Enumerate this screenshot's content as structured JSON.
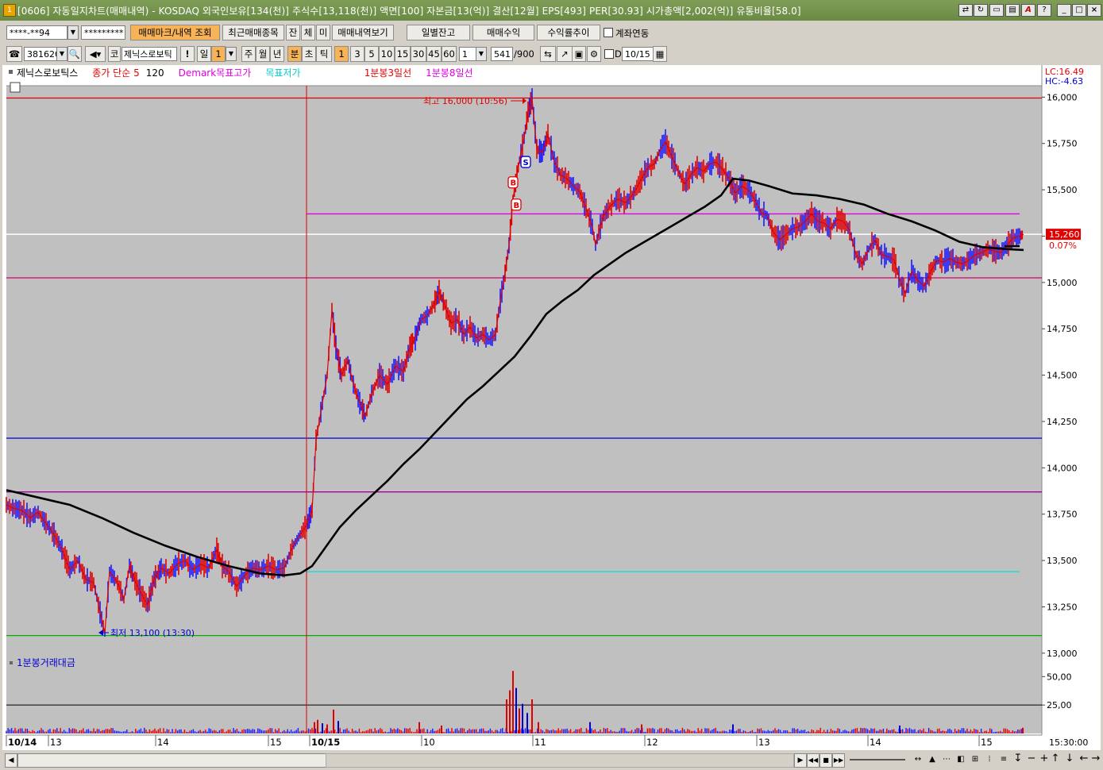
{
  "window": {
    "title": "[0606] 자동일지차트(매매내역) - KOSDAQ 외국인보유[134(천)] 주식수[13,118(천)] 액면[100] 자본금[13(억)] 결산[12월] EPS[493] PER[30.93] 시가총액[2,002(억)] 유통비율[58.0]",
    "icon": "app-icon"
  },
  "toolbar1": {
    "account": "****-**94",
    "password": "*********",
    "btn_trade_mark": "매매마크/내역 조회",
    "btn_recent_trades": "최근매매종목",
    "btn_jan": "잔",
    "btn_che": "체",
    "btn_mi": "미",
    "btn_trade_history": "매매내역보기",
    "btn_daily_balance": "일별잔고",
    "btn_profit": "매매수익",
    "btn_return_trend": "수익률추이",
    "link_account_label": "계좌연동"
  },
  "toolbar2": {
    "code": "381620",
    "name": "제닉스로보틱",
    "market_tag": "코",
    "bang": "!",
    "periods": [
      "일",
      "1",
      "주",
      "월",
      "년",
      "분",
      "초",
      "틱"
    ],
    "minute_values": [
      "1",
      "3",
      "5",
      "10",
      "15",
      "30",
      "45",
      "60"
    ],
    "interval": "1",
    "count": "541",
    "count_max": "/900",
    "date_check_label": "D",
    "date": "10/15"
  },
  "chart_data": {
    "type": "line",
    "legend": [
      {
        "name": "제닉스로보틱스",
        "color": "#000000"
      },
      {
        "name": "종가 단순 5",
        "color": "#e60000"
      },
      {
        "name": "120",
        "color": "#000000"
      },
      {
        "name": "Demark목표고가",
        "color": "#e000e0"
      },
      {
        "name": "목표저가",
        "color": "#00cccc"
      },
      {
        "name": "단기과열",
        "color": "#ffffff"
      },
      {
        "name": "1분봉3일선",
        "color": "#e60000"
      },
      {
        "name": "1분봉8일선",
        "color": "#e000e0"
      }
    ],
    "corner_lc": "LC:16.49",
    "corner_hc": "HC:-4.63",
    "y_ticks": [
      "16,000",
      "15,750",
      "15,500",
      "15,250",
      "15,000",
      "14,750",
      "14,500",
      "14,250",
      "14,000",
      "13,750",
      "13,500",
      "13,250",
      "13,000"
    ],
    "y_tick_values": [
      16000,
      15750,
      15500,
      15250,
      15000,
      14750,
      14500,
      14250,
      14000,
      13750,
      13500,
      13250,
      13000
    ],
    "ylim": [
      12995,
      16010
    ],
    "x_labels": [
      "10/14",
      "13",
      "14",
      "15",
      "10/15",
      "10",
      "11",
      "12",
      "13",
      "14",
      "15"
    ],
    "x_time_label": "15:30:00",
    "current_price": "15,260",
    "current_price_value": 15260,
    "current_change": "0.07%",
    "high_annotation": "최고 16,000 (10:56)",
    "low_annotation": "최저 13,100 (13:30)",
    "h_lines": [
      {
        "name": "red-top",
        "value": 15995,
        "color": "#e00000",
        "from": "10/14"
      },
      {
        "name": "magenta-demark-high",
        "value": 15370,
        "color": "#e000e0",
        "from": "10/15"
      },
      {
        "name": "current-price",
        "value": 15260,
        "color": "#ffffff",
        "from": "10/14"
      },
      {
        "name": "deep-pink",
        "value": 15025,
        "color": "#d6006b",
        "from": "10/14"
      },
      {
        "name": "blue",
        "value": 14160,
        "color": "#0000d0",
        "from": "10/14"
      },
      {
        "name": "purple",
        "value": 13870,
        "color": "#a000a0",
        "from": "10/14"
      },
      {
        "name": "cyan-target-low",
        "value": 13440,
        "color": "#00e0e0",
        "from": "10/15"
      },
      {
        "name": "green",
        "value": 13095,
        "color": "#00b000",
        "from": "10/14"
      }
    ],
    "price_path": [
      [
        0,
        13800
      ],
      [
        10,
        13780
      ],
      [
        20,
        13770
      ],
      [
        30,
        13730
      ],
      [
        40,
        13760
      ],
      [
        50,
        13700
      ],
      [
        60,
        13640
      ],
      [
        70,
        13560
      ],
      [
        80,
        13450
      ],
      [
        90,
        13500
      ],
      [
        100,
        13400
      ],
      [
        110,
        13380
      ],
      [
        118,
        13220
      ],
      [
        124,
        13110
      ],
      [
        130,
        13440
      ],
      [
        140,
        13380
      ],
      [
        148,
        13290
      ],
      [
        155,
        13470
      ],
      [
        162,
        13390
      ],
      [
        170,
        13320
      ],
      [
        178,
        13260
      ],
      [
        186,
        13400
      ],
      [
        195,
        13460
      ],
      [
        205,
        13430
      ],
      [
        215,
        13480
      ],
      [
        225,
        13500
      ],
      [
        235,
        13450
      ],
      [
        245,
        13480
      ],
      [
        255,
        13460
      ],
      [
        265,
        13560
      ],
      [
        272,
        13470
      ],
      [
        280,
        13440
      ],
      [
        290,
        13360
      ],
      [
        300,
        13420
      ],
      [
        310,
        13460
      ],
      [
        320,
        13450
      ],
      [
        330,
        13470
      ],
      [
        340,
        13450
      ],
      [
        350,
        13460
      ],
      [
        360,
        13570
      ],
      [
        370,
        13640
      ],
      [
        378,
        13690
      ],
      [
        385,
        13770
      ],
      [
        390,
        14150
      ],
      [
        396,
        14300
      ],
      [
        404,
        14500
      ],
      [
        410,
        14850
      ],
      [
        415,
        14650
      ],
      [
        422,
        14500
      ],
      [
        430,
        14580
      ],
      [
        437,
        14450
      ],
      [
        445,
        14350
      ],
      [
        452,
        14280
      ],
      [
        460,
        14400
      ],
      [
        470,
        14500
      ],
      [
        480,
        14450
      ],
      [
        490,
        14550
      ],
      [
        500,
        14520
      ],
      [
        508,
        14650
      ],
      [
        515,
        14700
      ],
      [
        522,
        14800
      ],
      [
        530,
        14820
      ],
      [
        538,
        14880
      ],
      [
        545,
        14950
      ],
      [
        552,
        14880
      ],
      [
        560,
        14780
      ],
      [
        568,
        14800
      ],
      [
        576,
        14720
      ],
      [
        584,
        14760
      ],
      [
        592,
        14700
      ],
      [
        600,
        14720
      ],
      [
        608,
        14690
      ],
      [
        616,
        14720
      ],
      [
        622,
        14900
      ],
      [
        628,
        15050
      ],
      [
        633,
        15200
      ],
      [
        638,
        15450
      ],
      [
        643,
        15580
      ],
      [
        648,
        15700
      ],
      [
        652,
        15780
      ],
      [
        657,
        15920
      ],
      [
        662,
        15990
      ],
      [
        668,
        15720
      ],
      [
        675,
        15700
      ],
      [
        682,
        15800
      ],
      [
        690,
        15650
      ],
      [
        698,
        15580
      ],
      [
        706,
        15560
      ],
      [
        714,
        15520
      ],
      [
        722,
        15490
      ],
      [
        730,
        15400
      ],
      [
        738,
        15300
      ],
      [
        742,
        15200
      ],
      [
        746,
        15270
      ],
      [
        752,
        15360
      ],
      [
        760,
        15410
      ],
      [
        770,
        15450
      ],
      [
        780,
        15430
      ],
      [
        790,
        15480
      ],
      [
        800,
        15560
      ],
      [
        808,
        15620
      ],
      [
        816,
        15640
      ],
      [
        824,
        15720
      ],
      [
        830,
        15760
      ],
      [
        838,
        15680
      ],
      [
        846,
        15600
      ],
      [
        854,
        15530
      ],
      [
        862,
        15580
      ],
      [
        870,
        15620
      ],
      [
        878,
        15600
      ],
      [
        886,
        15640
      ],
      [
        894,
        15650
      ],
      [
        902,
        15610
      ],
      [
        910,
        15560
      ],
      [
        918,
        15480
      ],
      [
        926,
        15520
      ],
      [
        934,
        15500
      ],
      [
        942,
        15450
      ],
      [
        950,
        15380
      ],
      [
        958,
        15360
      ],
      [
        966,
        15270
      ],
      [
        974,
        15230
      ],
      [
        982,
        15260
      ],
      [
        990,
        15290
      ],
      [
        998,
        15300
      ],
      [
        1006,
        15330
      ],
      [
        1014,
        15370
      ],
      [
        1022,
        15330
      ],
      [
        1030,
        15320
      ],
      [
        1038,
        15290
      ],
      [
        1046,
        15340
      ],
      [
        1054,
        15330
      ],
      [
        1062,
        15280
      ],
      [
        1070,
        15150
      ],
      [
        1078,
        15100
      ],
      [
        1086,
        15180
      ],
      [
        1094,
        15230
      ],
      [
        1102,
        15150
      ],
      [
        1110,
        15140
      ],
      [
        1118,
        15120
      ],
      [
        1126,
        15000
      ],
      [
        1132,
        14940
      ],
      [
        1140,
        15060
      ],
      [
        1148,
        15010
      ],
      [
        1156,
        14980
      ],
      [
        1164,
        15060
      ],
      [
        1172,
        15120
      ],
      [
        1180,
        15110
      ],
      [
        1188,
        15130
      ],
      [
        1196,
        15110
      ],
      [
        1204,
        15100
      ],
      [
        1212,
        15120
      ],
      [
        1220,
        15150
      ],
      [
        1228,
        15160
      ],
      [
        1236,
        15180
      ],
      [
        1244,
        15170
      ],
      [
        1252,
        15160
      ],
      [
        1260,
        15200
      ],
      [
        1268,
        15240
      ],
      [
        1276,
        15250
      ],
      [
        1281,
        15260
      ]
    ],
    "ma120_path": [
      [
        0,
        13880
      ],
      [
        40,
        13840
      ],
      [
        80,
        13800
      ],
      [
        120,
        13730
      ],
      [
        160,
        13650
      ],
      [
        200,
        13580
      ],
      [
        240,
        13520
      ],
      [
        280,
        13470
      ],
      [
        320,
        13430
      ],
      [
        350,
        13420
      ],
      [
        370,
        13430
      ],
      [
        385,
        13470
      ],
      [
        400,
        13560
      ],
      [
        420,
        13680
      ],
      [
        440,
        13770
      ],
      [
        460,
        13850
      ],
      [
        480,
        13930
      ],
      [
        500,
        14020
      ],
      [
        520,
        14100
      ],
      [
        540,
        14190
      ],
      [
        560,
        14280
      ],
      [
        580,
        14370
      ],
      [
        600,
        14440
      ],
      [
        620,
        14520
      ],
      [
        640,
        14600
      ],
      [
        660,
        14710
      ],
      [
        680,
        14830
      ],
      [
        700,
        14900
      ],
      [
        720,
        14960
      ],
      [
        740,
        15040
      ],
      [
        760,
        15100
      ],
      [
        780,
        15160
      ],
      [
        800,
        15210
      ],
      [
        820,
        15260
      ],
      [
        840,
        15310
      ],
      [
        860,
        15360
      ],
      [
        880,
        15410
      ],
      [
        900,
        15470
      ],
      [
        915,
        15560
      ],
      [
        935,
        15550
      ],
      [
        960,
        15520
      ],
      [
        990,
        15480
      ],
      [
        1020,
        15470
      ],
      [
        1050,
        15450
      ],
      [
        1080,
        15420
      ],
      [
        1110,
        15370
      ],
      [
        1140,
        15330
      ],
      [
        1170,
        15280
      ],
      [
        1200,
        15220
      ],
      [
        1230,
        15190
      ],
      [
        1260,
        15180
      ],
      [
        1281,
        15175
      ]
    ],
    "signals": [
      {
        "label": "S",
        "x": 654,
        "value": 15650
      },
      {
        "label": "B",
        "x": 638,
        "value": 15540
      },
      {
        "label": "B",
        "x": 642,
        "value": 15420
      }
    ],
    "volume_panel": {
      "label": "1분봉거래대금",
      "y_ticks": [
        "50,00",
        "25,00"
      ],
      "y_tick_values": [
        50,
        25
      ],
      "ymax": 60,
      "ref_line_value": 25,
      "spikes": [
        {
          "x": 388,
          "value": 10,
          "color": "#e00000"
        },
        {
          "x": 392,
          "value": 12,
          "color": "#e00000"
        },
        {
          "x": 398,
          "value": 9,
          "color": "#0000d0"
        },
        {
          "x": 404,
          "value": 8,
          "color": "#e00000"
        },
        {
          "x": 412,
          "value": 21,
          "color": "#e00000"
        },
        {
          "x": 418,
          "value": 11,
          "color": "#0000d0"
        },
        {
          "x": 520,
          "value": 10,
          "color": "#e00000"
        },
        {
          "x": 548,
          "value": 7,
          "color": "#e00000"
        },
        {
          "x": 630,
          "value": 30,
          "color": "#e00000"
        },
        {
          "x": 634,
          "value": 38,
          "color": "#e00000"
        },
        {
          "x": 638,
          "value": 55,
          "color": "#e00000"
        },
        {
          "x": 642,
          "value": 40,
          "color": "#0000d0"
        },
        {
          "x": 646,
          "value": 22,
          "color": "#e00000"
        },
        {
          "x": 650,
          "value": 26,
          "color": "#0000d0"
        },
        {
          "x": 656,
          "value": 18,
          "color": "#0000d0"
        },
        {
          "x": 662,
          "value": 30,
          "color": "#e00000"
        },
        {
          "x": 670,
          "value": 10,
          "color": "#e00000"
        },
        {
          "x": 735,
          "value": 10,
          "color": "#0000d0"
        },
        {
          "x": 800,
          "value": 8,
          "color": "#e00000"
        },
        {
          "x": 915,
          "value": 8,
          "color": "#0000d0"
        },
        {
          "x": 1125,
          "value": 7,
          "color": "#0000d0"
        },
        {
          "x": 1280,
          "value": 5,
          "color": "#e00000"
        }
      ]
    }
  }
}
